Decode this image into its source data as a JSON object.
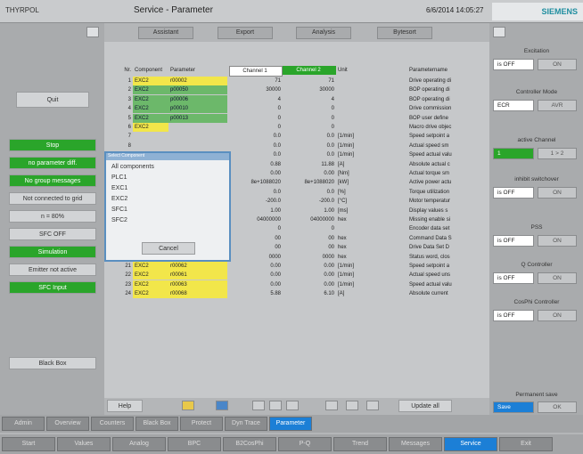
{
  "header": {
    "app_name": "THYRPOL",
    "title": "Service - Parameter",
    "datetime": "6/6/2014  14:05:27",
    "logo": "SIEMENS"
  },
  "toolbar": [
    "Assistant",
    "Export",
    "Analysis",
    "Bytesort"
  ],
  "left_panel": {
    "items": [
      {
        "label": "Quit",
        "style": "light"
      },
      {
        "label": "Stop",
        "style": "green"
      },
      {
        "label": "no parameter diff.",
        "style": "green"
      },
      {
        "label": "No group messages",
        "style": "green"
      },
      {
        "label": "Not connected to grid",
        "style": "light"
      },
      {
        "label": "n = 80%",
        "style": "light"
      },
      {
        "label": "SFC OFF",
        "style": "light"
      },
      {
        "label": "Simulation",
        "style": "green"
      },
      {
        "label": "Emitter not active",
        "style": "light"
      },
      {
        "label": "SFC Input",
        "style": "green"
      },
      {
        "label": "Black Box",
        "style": "light"
      }
    ]
  },
  "table": {
    "headers": {
      "nr": "Nr.",
      "component": "Component",
      "parameter": "Parameter",
      "channel1": "Channel 1",
      "channel2": "Channel 2",
      "unit": "Unit",
      "name": "Parametername"
    },
    "rows": [
      {
        "nr": "1",
        "comp": "EXC2",
        "param": "r00002",
        "ch1": "71",
        "ch2": "71",
        "unit": "",
        "name": "Drive operating di",
        "color": "y"
      },
      {
        "nr": "2",
        "comp": "EXC2",
        "param": "p00050",
        "ch1": "30000",
        "ch2": "30000",
        "unit": "",
        "name": "BOP operating di",
        "color": "g"
      },
      {
        "nr": "3",
        "comp": "EXC2",
        "param": "p00006",
        "ch1": "4",
        "ch2": "4",
        "unit": "",
        "name": "BOP operating di",
        "color": "g"
      },
      {
        "nr": "4",
        "comp": "EXC2",
        "param": "p00010",
        "ch1": "0",
        "ch2": "0",
        "unit": "",
        "name": "Drive commission",
        "color": "g"
      },
      {
        "nr": "5",
        "comp": "EXC2",
        "param": "p00013",
        "ch1": "0",
        "ch2": "0",
        "unit": "",
        "name": "BOP user define",
        "color": "g"
      },
      {
        "nr": "6",
        "comp": "EXC2",
        "param": "",
        "ch1": "0",
        "ch2": "0",
        "unit": "",
        "name": "Macro drive objec",
        "color": "y"
      },
      {
        "nr": "7",
        "comp": "",
        "param": "",
        "ch1": "0.0",
        "ch2": "0.0",
        "unit": "[1/min]",
        "name": "Speed setpoint a",
        "color": "y"
      },
      {
        "nr": "8",
        "comp": "",
        "param": "",
        "ch1": "0.0",
        "ch2": "0.0",
        "unit": "[1/min]",
        "name": "Actual speed sm",
        "color": "y"
      },
      {
        "nr": "9",
        "comp": "",
        "param": "",
        "ch1": "0.0",
        "ch2": "0.0",
        "unit": "[1/min]",
        "name": "Speed actual valu",
        "color": "y"
      },
      {
        "nr": "10",
        "comp": "",
        "param": "",
        "ch1": "0.88",
        "ch2": "11.88",
        "unit": "[A]",
        "name": "Absolute actual c",
        "color": "y"
      },
      {
        "nr": "11",
        "comp": "",
        "param": "",
        "ch1": "0.00",
        "ch2": "0.00",
        "unit": "[Nm]",
        "name": "Actual torque sm",
        "color": "y"
      },
      {
        "nr": "12",
        "comp": "",
        "param": "",
        "ch1": "8e+1088020",
        "ch2": "8e+1088020",
        "unit": "[kW]",
        "name": "Active power actu",
        "color": "y"
      },
      {
        "nr": "13",
        "comp": "",
        "param": "",
        "ch1": "0.0",
        "ch2": "0.0",
        "unit": "[%]",
        "name": "Torque utilization",
        "color": "y"
      },
      {
        "nr": "14",
        "comp": "",
        "param": "",
        "ch1": "-200.0",
        "ch2": "-200.0",
        "unit": "[°C]",
        "name": "Motor temperatur",
        "color": "y"
      },
      {
        "nr": "15",
        "comp": "EXC2",
        "param": "p00040",
        "ch1": "1.00",
        "ch2": "1.00",
        "unit": "[ms]",
        "name": "Display values s",
        "color": "g"
      },
      {
        "nr": "16",
        "comp": "EXC2",
        "param": "r00046",
        "ch1": "04000000",
        "ch2": "04000000",
        "unit": "hex",
        "name": "Missing enable si",
        "color": "y"
      },
      {
        "nr": "17",
        "comp": "EXC2",
        "param": "r00049",
        "ch1": "0",
        "ch2": "0",
        "unit": "",
        "name": "Encoder data set",
        "color": "y"
      },
      {
        "nr": "18",
        "comp": "EXC2",
        "param": "r00050",
        "ch1": "00",
        "ch2": "00",
        "unit": "hex",
        "name": "Command Data S",
        "color": "y"
      },
      {
        "nr": "19",
        "comp": "EXC2",
        "param": "r00051",
        "ch1": "00",
        "ch2": "00",
        "unit": "hex",
        "name": "Drive Data Set D",
        "color": "y"
      },
      {
        "nr": "20",
        "comp": "EXC2",
        "param": "r00056",
        "ch1": "0000",
        "ch2": "0000",
        "unit": "hex",
        "name": "Status word, clos",
        "color": "y"
      },
      {
        "nr": "21",
        "comp": "EXC2",
        "param": "r00062",
        "ch1": "0.00",
        "ch2": "0.00",
        "unit": "[1/min]",
        "name": "Speed setpoint a",
        "color": "y"
      },
      {
        "nr": "22",
        "comp": "EXC2",
        "param": "r00061",
        "ch1": "0.00",
        "ch2": "0.00",
        "unit": "[1/min]",
        "name": "Actual speed uns",
        "color": "y"
      },
      {
        "nr": "23",
        "comp": "EXC2",
        "param": "r00063",
        "ch1": "0.00",
        "ch2": "0.00",
        "unit": "[1/min]",
        "name": "Speed actual valu",
        "color": "y"
      },
      {
        "nr": "24",
        "comp": "EXC2",
        "param": "r00068",
        "ch1": "5.88",
        "ch2": "6.10",
        "unit": "[A]",
        "name": "Absolute current",
        "color": "y"
      }
    ],
    "help_label": "Help",
    "update_label": "Update all"
  },
  "dialog": {
    "title": "Select Component",
    "items": [
      "All components",
      "PLC1",
      "EXC1",
      "EXC2",
      "SFC1",
      "SFC2"
    ],
    "cancel_label": "Cancel"
  },
  "right_panel": {
    "excitation_label": "Excitation",
    "excitation_value": "is OFF",
    "excitation_btn": "ON",
    "ctrl_mode_label": "Controller Mode",
    "ctrl_mode_value": "ECR",
    "ctrl_mode_btn": "AVR",
    "active_channel_label": "active Channel",
    "channel_1": "1",
    "channel_2": "1 > 2",
    "inhibit_label": "inhibit switchover",
    "inhibit_value": "is OFF",
    "inhibit_btn": "ON",
    "pss_label": "PSS",
    "pss_value": "is OFF",
    "pss_btn": "ON",
    "q_ctrl_label": "Q Controller",
    "q_ctrl_value": "is OFF",
    "q_ctrl_btn": "ON",
    "cosphi_label": "CosPhi Controller",
    "cosphi_value": "is OFF",
    "cosphi_btn": "ON",
    "perm_label": "Permanent save",
    "perm_value": "Save",
    "perm_btn": "OK"
  },
  "bottom_tabs_1": [
    "Admin",
    "Overview",
    "Counters",
    "Black Box",
    "Protect",
    "Dyn Trace",
    "Parameter"
  ],
  "bottom_tabs_1_active": "Parameter",
  "bottom_tabs_2": [
    "Start",
    "Values",
    "Analog",
    "BPC",
    "B2CosPhi",
    "P-Q",
    "Trend",
    "Messages",
    "Service",
    "Exit"
  ],
  "bottom_tabs_2_active": "Service",
  "colors": {
    "accent_blue": "#1c7fd6",
    "green": "#2aa52a",
    "yellow": "#f2e64a",
    "row_green": "#6cb86a"
  }
}
